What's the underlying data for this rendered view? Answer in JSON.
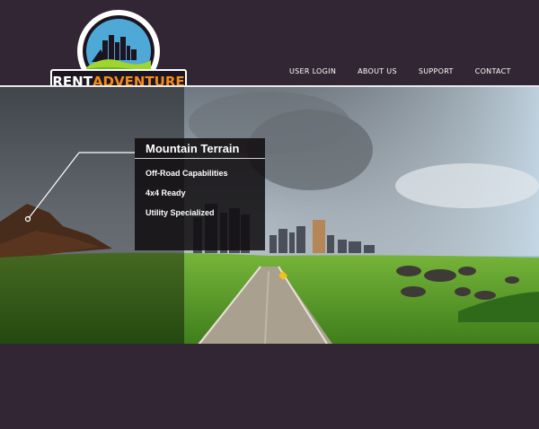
{
  "brand": {
    "name_part1": "RENT",
    "name_part2": "ADVENTURE",
    "accent_color": "#f28c1c"
  },
  "nav": {
    "items": [
      {
        "label": "USER LOGIN"
      },
      {
        "label": "ABOUT US"
      },
      {
        "label": "SUPPORT"
      },
      {
        "label": "CONTACT"
      }
    ]
  },
  "hero": {
    "panel": {
      "title": "Mountain Terrain",
      "features": [
        "Off-Road Capabilities",
        "4x4 Ready",
        "Utility Specialized"
      ]
    }
  },
  "colors": {
    "background": "#332634",
    "grass": "#5a9a2a",
    "sky": "#9eb0c0"
  }
}
